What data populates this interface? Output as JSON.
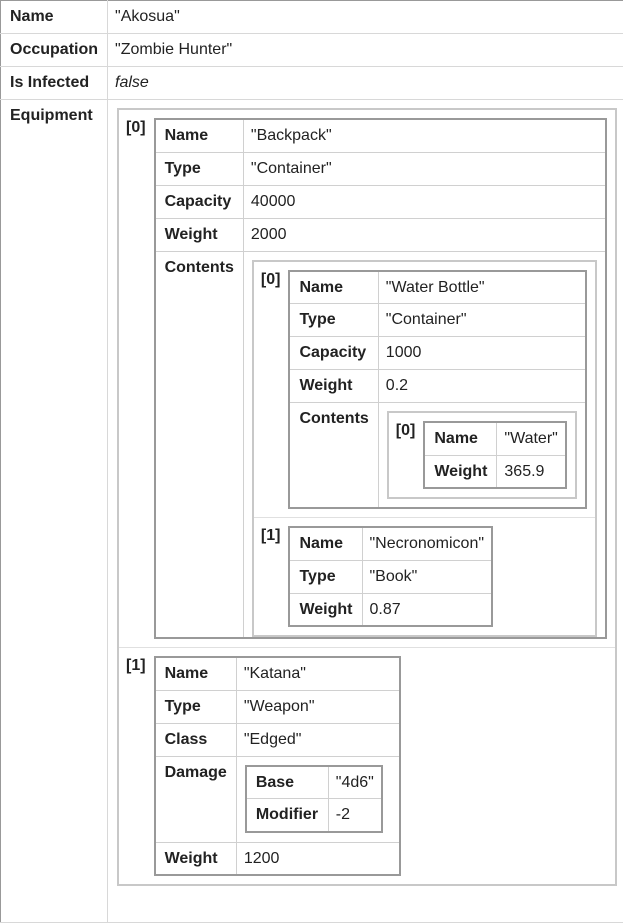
{
  "root": {
    "name": {
      "label": "Name",
      "value": "\"Akosua\""
    },
    "occupation": {
      "label": "Occupation",
      "value": "\"Zombie Hunter\""
    },
    "infected": {
      "label": "Is Infected",
      "value": "false"
    },
    "equipment_label": "Equipment"
  },
  "equipment": [
    {
      "index": "[0]",
      "name": {
        "label": "Name",
        "value": "\"Backpack\""
      },
      "type": {
        "label": "Type",
        "value": "\"Container\""
      },
      "capacity": {
        "label": "Capacity",
        "value": "40000"
      },
      "weight": {
        "label": "Weight",
        "value": "2000"
      },
      "contents_label": "Contents",
      "contents": [
        {
          "index": "[0]",
          "name": {
            "label": "Name",
            "value": "\"Water Bottle\""
          },
          "type": {
            "label": "Type",
            "value": "\"Container\""
          },
          "capacity": {
            "label": "Capacity",
            "value": "1000"
          },
          "weight": {
            "label": "Weight",
            "value": "0.2"
          },
          "contents_label": "Contents",
          "contents": [
            {
              "index": "[0]",
              "name": {
                "label": "Name",
                "value": "\"Water\""
              },
              "weight": {
                "label": "Weight",
                "value": "365.9"
              }
            }
          ]
        },
        {
          "index": "[1]",
          "name": {
            "label": "Name",
            "value": "\"Necronomicon\""
          },
          "type": {
            "label": "Type",
            "value": "\"Book\""
          },
          "weight": {
            "label": "Weight",
            "value": "0.87"
          }
        }
      ]
    },
    {
      "index": "[1]",
      "name": {
        "label": "Name",
        "value": "\"Katana\""
      },
      "type": {
        "label": "Type",
        "value": "\"Weapon\""
      },
      "class": {
        "label": "Class",
        "value": "\"Edged\""
      },
      "damage_label": "Damage",
      "damage": {
        "base": {
          "label": "Base",
          "value": "\"4d6\""
        },
        "modifier": {
          "label": "Modifier",
          "value": "-2"
        }
      },
      "weight": {
        "label": "Weight",
        "value": "1200"
      }
    }
  ]
}
